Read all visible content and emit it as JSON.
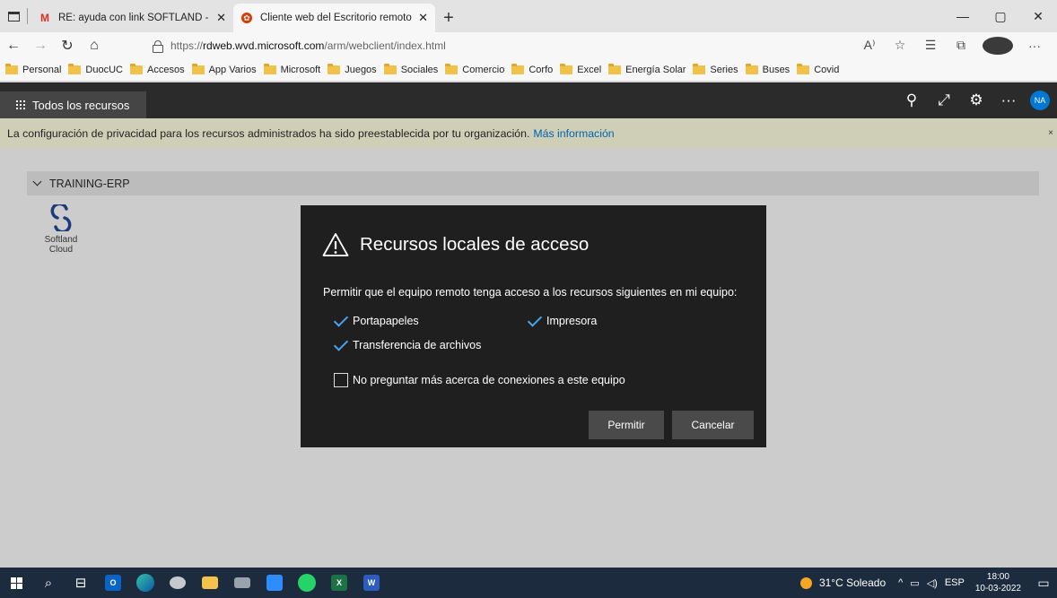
{
  "browser": {
    "tabs": [
      {
        "title": "RE: ayuda con link SOFTLAND - c",
        "favicon": "gmail-icon",
        "active": false
      },
      {
        "title": "Cliente web del Escritorio remoto",
        "favicon": "remote-desktop-icon",
        "active": true
      }
    ],
    "new_tab": "+",
    "window_controls": {
      "minimize": "—",
      "restore": "▢",
      "close": "✕"
    },
    "nav": {
      "back": "←",
      "forward": "→",
      "reload": "↻",
      "home": "⌂"
    },
    "url": {
      "scheme": "https://",
      "host": "rdweb.wvd.microsoft.com",
      "path": "/arm/webclient/index.html"
    },
    "toolbar_icons": {
      "read_aloud": "A⁾",
      "favorite": "☆",
      "favorites": "☰",
      "collections": "⧉",
      "menu": "···"
    },
    "bookmarks": [
      "Personal",
      "DuocUC",
      "Accesos",
      "App Varios",
      "Microsoft",
      "Juegos",
      "Sociales",
      "Comercio",
      "Corfo",
      "Excel",
      "Energía Solar",
      "Series",
      "Buses",
      "Covid"
    ]
  },
  "app": {
    "all_resources": "Todos los recursos",
    "header_icons": {
      "pin": "⚲",
      "fullscreen": "⤢",
      "settings": "⚙",
      "more": "···"
    },
    "user_initials": "NA",
    "info_text": "La configuración de privacidad para los recursos administrados ha sido preestablecida por tu organización.",
    "info_link": "Más información",
    "info_close": "×",
    "group_name": "TRAINING-ERP",
    "resource": {
      "label_line1": "Softland",
      "label_line2": "Cloud"
    }
  },
  "dialog": {
    "title": "Recursos locales de acceso",
    "description": "Permitir que el equipo remoto tenga acceso a los recursos siguientes en mi equipo:",
    "options": [
      {
        "label": "Portapapeles",
        "checked": true
      },
      {
        "label": "Impresora",
        "checked": true
      },
      {
        "label": "Transferencia de archivos",
        "checked": true
      }
    ],
    "dont_ask": {
      "label": "No preguntar más acerca de conexiones a este equipo",
      "checked": false
    },
    "allow_button": "Permitir",
    "cancel_button": "Cancelar"
  },
  "taskbar": {
    "weather": "31°C Soleado",
    "tray_symbols": {
      "chevron": "^",
      "network": "▭",
      "speaker": "◁)"
    },
    "language": "ESP",
    "time": "18:00",
    "date": "10-03-2022"
  },
  "colors": {
    "dialog_bg": "#1f1f1f",
    "accent": "#0078d4",
    "check": "#4aa3f0",
    "taskbar": "#1c2b3e",
    "infobar": "#cfcfb7"
  }
}
